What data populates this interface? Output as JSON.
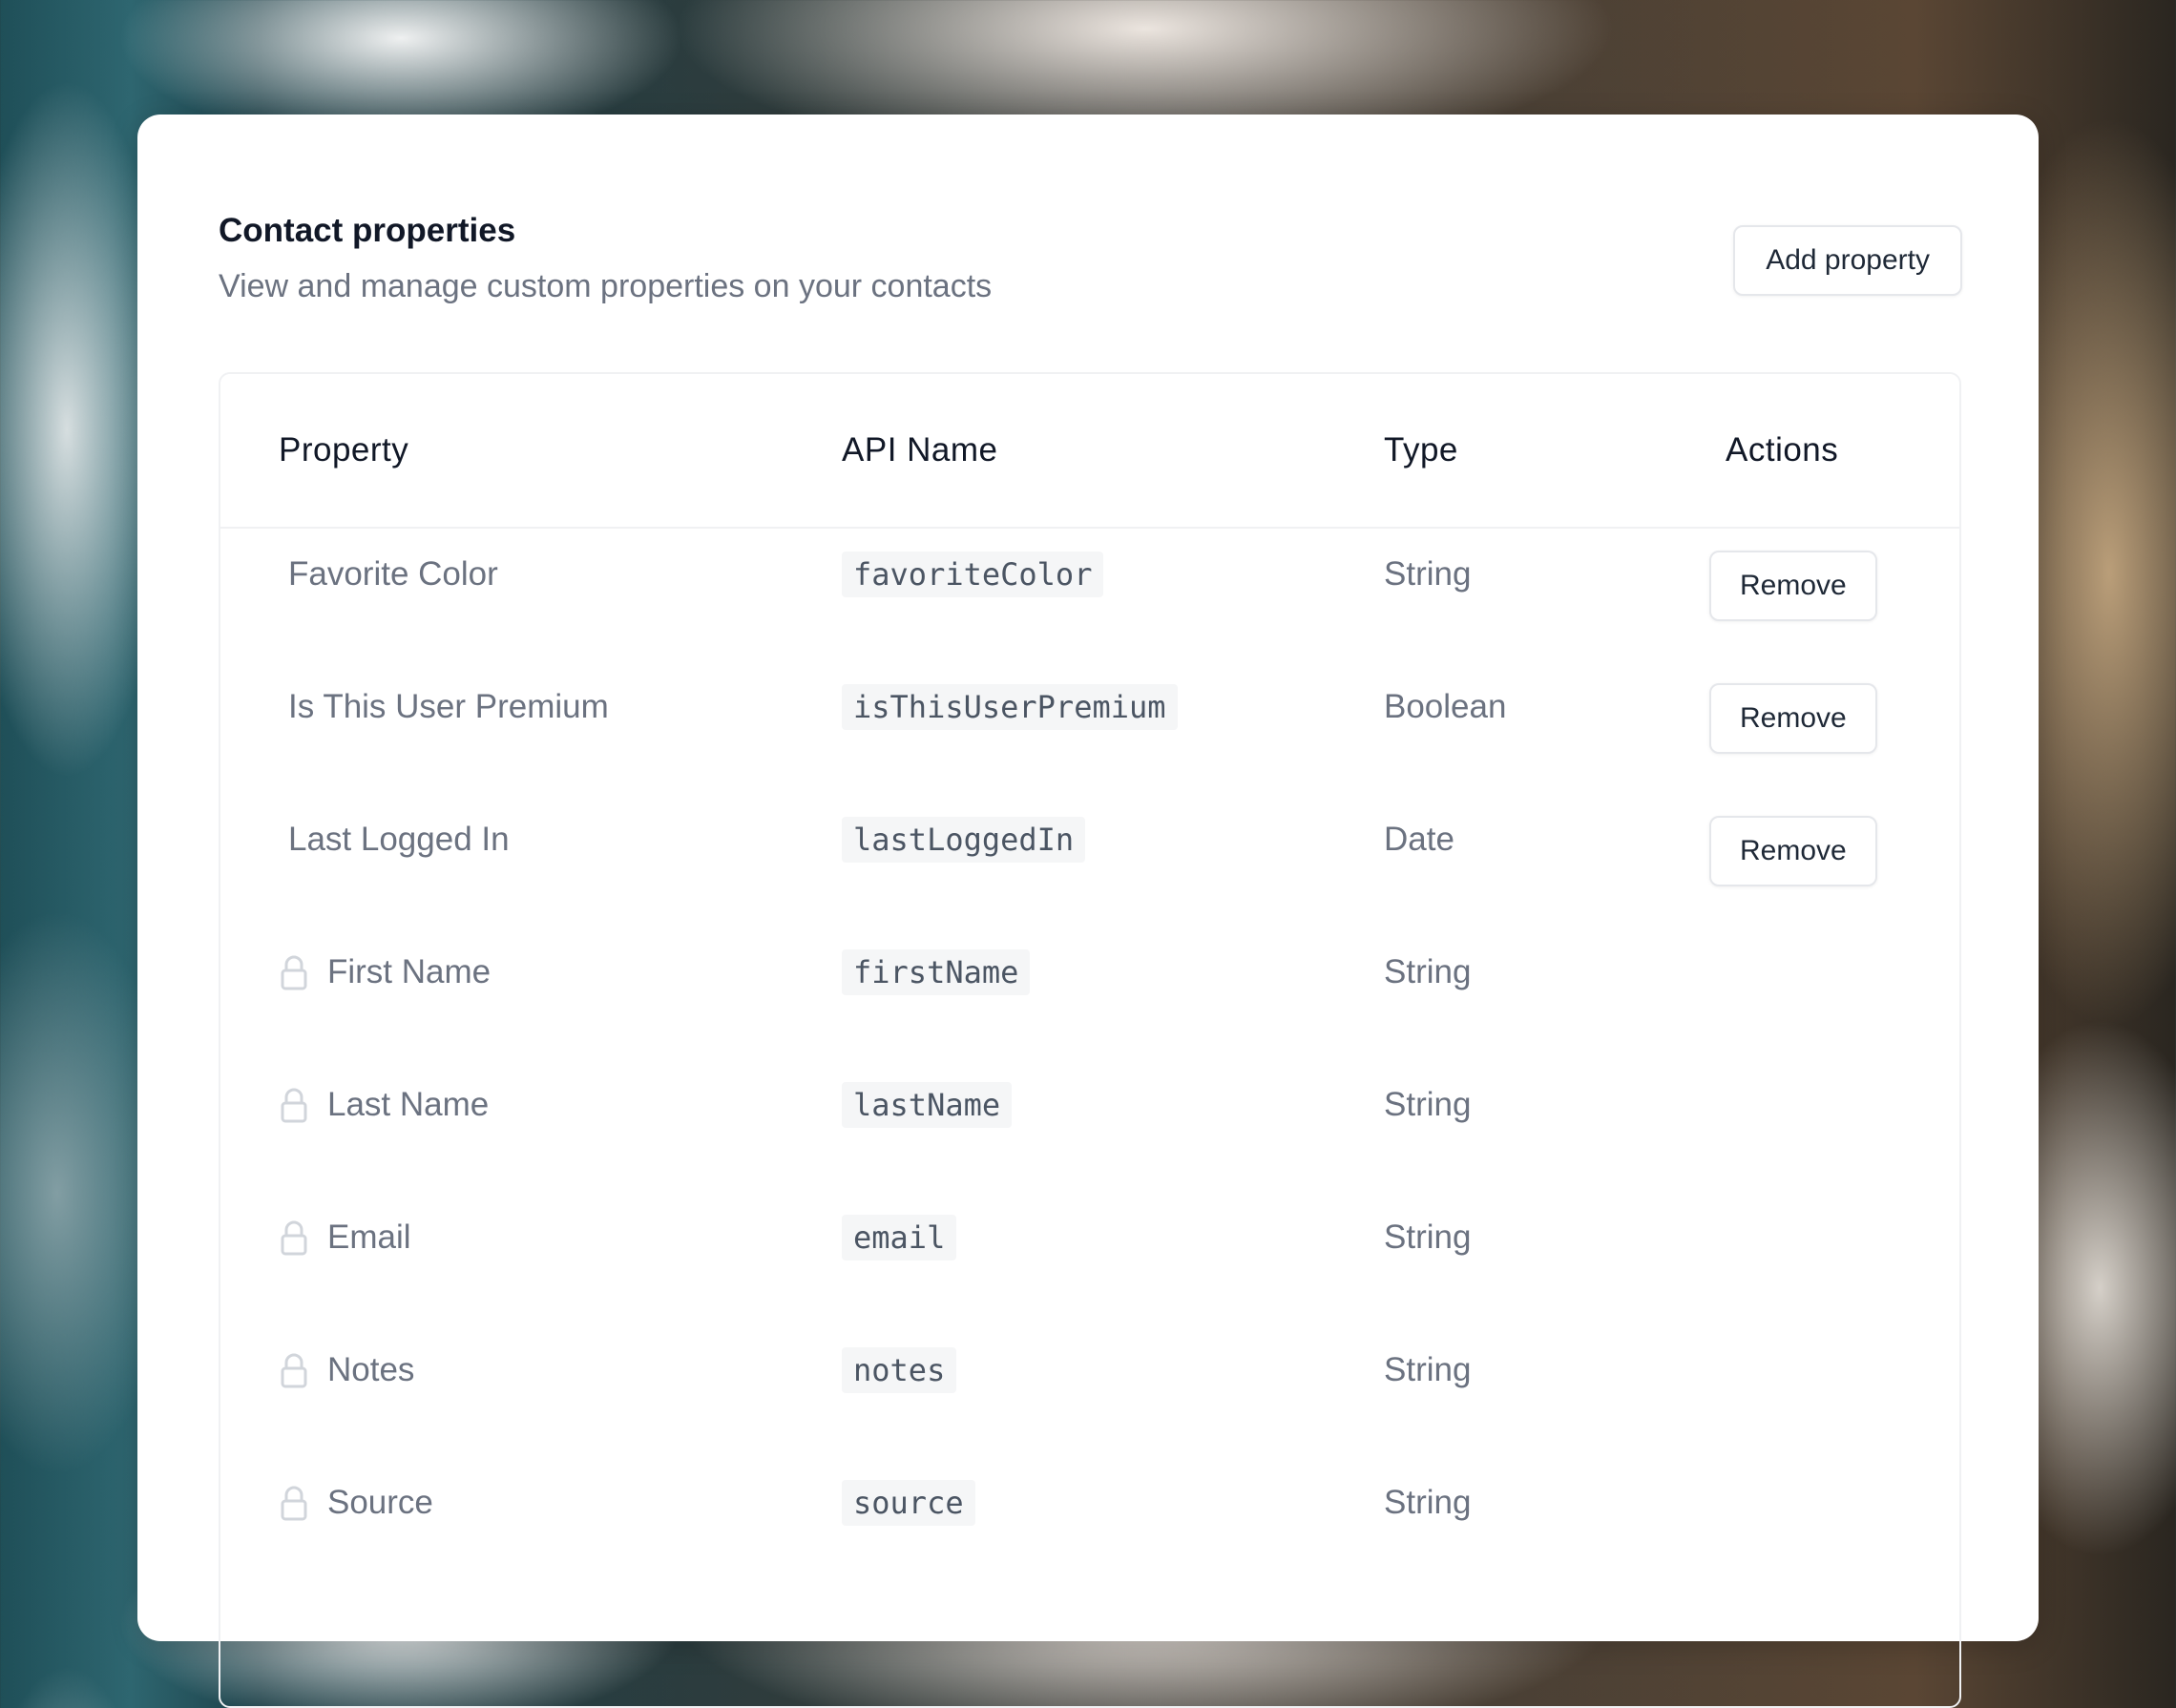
{
  "header": {
    "title": "Contact properties",
    "subtitle": "View and manage custom properties on your contacts",
    "add_button_label": "Add property"
  },
  "table": {
    "columns": {
      "property": "Property",
      "api_name": "API Name",
      "type": "Type",
      "actions": "Actions"
    },
    "rows": [
      {
        "property": "Favorite Color",
        "api_name": "favoriteColor",
        "type": "String",
        "locked": false,
        "action_label": "Remove"
      },
      {
        "property": "Is This User Premium",
        "api_name": "isThisUserPremium",
        "type": "Boolean",
        "locked": false,
        "action_label": "Remove"
      },
      {
        "property": "Last Logged In",
        "api_name": "lastLoggedIn",
        "type": "Date",
        "locked": false,
        "action_label": "Remove"
      },
      {
        "property": "First Name",
        "api_name": "firstName",
        "type": "String",
        "locked": true
      },
      {
        "property": "Last Name",
        "api_name": "lastName",
        "type": "String",
        "locked": true
      },
      {
        "property": "Email",
        "api_name": "email",
        "type": "String",
        "locked": true
      },
      {
        "property": "Notes",
        "api_name": "notes",
        "type": "String",
        "locked": true
      },
      {
        "property": "Source",
        "api_name": "source",
        "type": "String",
        "locked": true
      }
    ]
  },
  "icons": {
    "lock": "lock-icon"
  },
  "colors": {
    "title": "#111827",
    "muted_text": "#6b7280",
    "border": "#e5e7eb",
    "code_bg": "#f5f6f7"
  }
}
